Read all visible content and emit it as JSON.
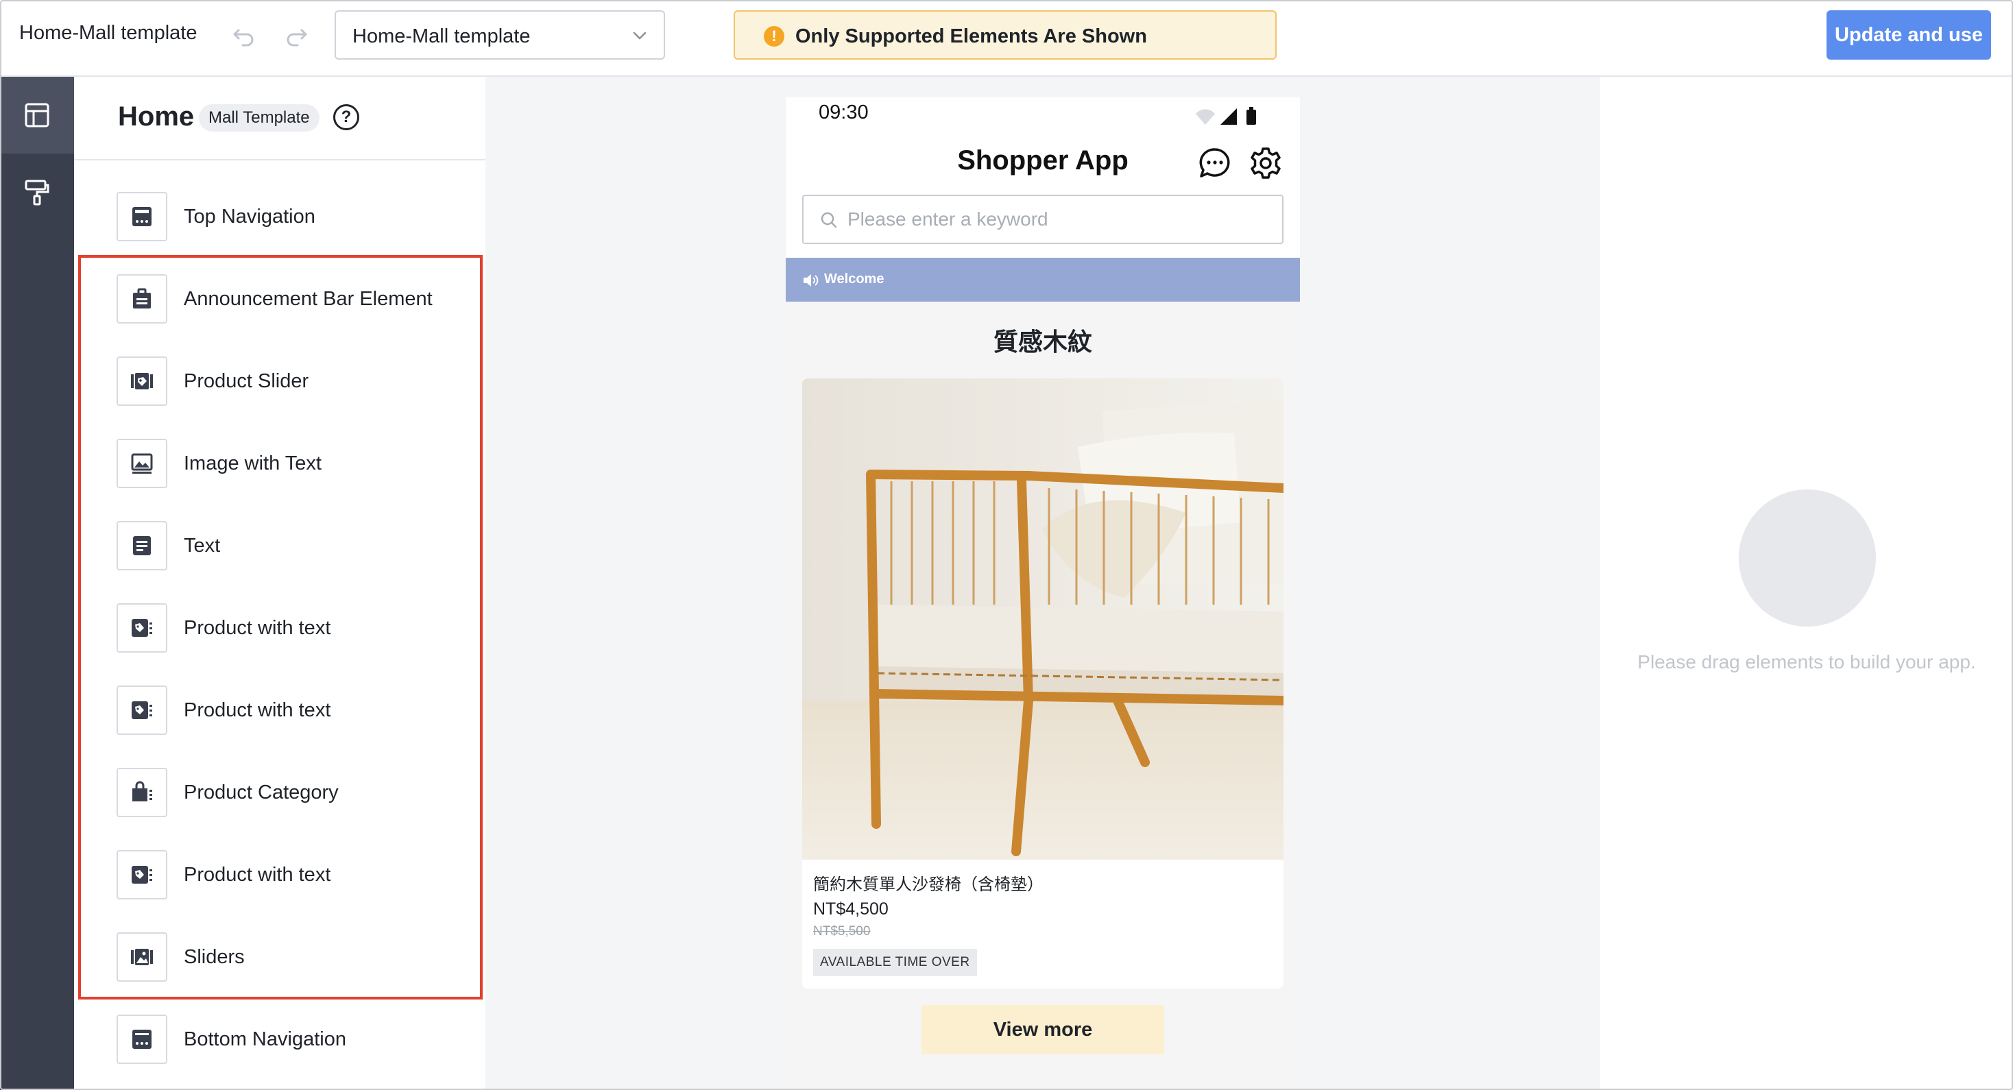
{
  "header": {
    "title": "Home-Mall template",
    "template_select": "Home-Mall template",
    "notice": "Only Supported Elements Are Shown",
    "update_button": "Update and use"
  },
  "rail": {
    "items": [
      {
        "icon": "layout-icon",
        "active": true
      },
      {
        "icon": "paint-roller-icon",
        "active": false
      }
    ]
  },
  "panel": {
    "title": "Home",
    "badge": "Mall Template",
    "help": "?",
    "components": [
      {
        "label": "Top Navigation",
        "icon": "top-navigation-icon"
      },
      {
        "label": "Announcement Bar Element",
        "icon": "announcement-icon"
      },
      {
        "label": "Product Slider",
        "icon": "product-slider-icon"
      },
      {
        "label": "Image with Text",
        "icon": "image-icon"
      },
      {
        "label": "Text",
        "icon": "text-icon"
      },
      {
        "label": "Product with text",
        "icon": "product-tag-icon"
      },
      {
        "label": "Product with text",
        "icon": "product-tag-icon"
      },
      {
        "label": "Product Category",
        "icon": "shopping-bag-icon"
      },
      {
        "label": "Product with text",
        "icon": "product-tag-icon"
      },
      {
        "label": "Sliders",
        "icon": "sliders-icon"
      },
      {
        "label": "Bottom Navigation",
        "icon": "bottom-navigation-icon"
      }
    ]
  },
  "phone": {
    "time": "09:30",
    "app_title": "Shopper App",
    "search_placeholder": "Please enter a keyword",
    "announcement": "Welcome",
    "section_title": "質感木紋",
    "product": {
      "name": "簡約木質單人沙發椅（含椅墊）",
      "price": "NT$4,500",
      "original_price": "NT$5,500",
      "tag": "AVAILABLE TIME OVER"
    },
    "view_more": "View more"
  },
  "right_panel": {
    "hint": "Please drag elements to build your app."
  },
  "colors": {
    "primary": "#5b8def",
    "highlight_border": "#e1412e",
    "notice_bg": "#fcf3dd",
    "announcement_bg": "#95a7d4",
    "view_more_bg": "#fbefcf",
    "rail_bg": "#3a3f4d"
  }
}
